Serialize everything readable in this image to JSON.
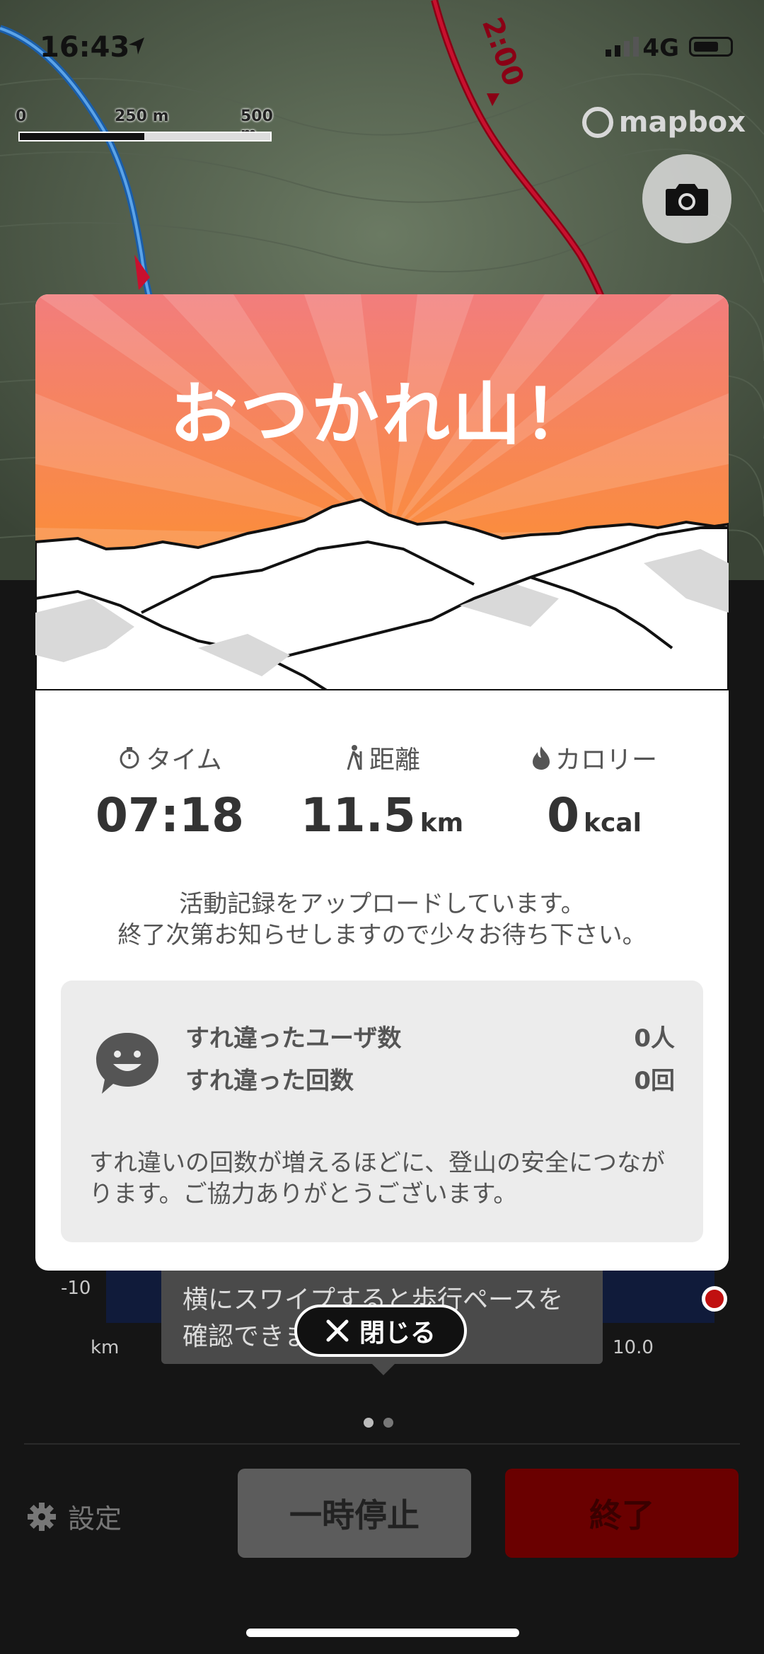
{
  "status": {
    "time": "16:43",
    "network": "4G"
  },
  "map": {
    "scale_labels": [
      "0",
      "250 m",
      "500 m"
    ],
    "brand": "mapbox",
    "route_label": "2:00"
  },
  "modal": {
    "title": "おつかれ山！",
    "stats": [
      {
        "label": "タイム",
        "value": "07:18",
        "unit": "",
        "icon": "stopwatch-icon"
      },
      {
        "label": "距離",
        "value": "11.5",
        "unit": "km",
        "icon": "hiker-icon"
      },
      {
        "label": "カロリー",
        "value": "0",
        "unit": "kcal",
        "icon": "flame-icon"
      }
    ],
    "note_line1": "活動記録をアップロードしています。",
    "note_line2": "終了次第お知らせしますので少々お待ち下さい。",
    "pass": {
      "users_label": "すれ違ったユーザ数",
      "users_value": "0人",
      "count_label": "すれ違った回数",
      "count_value": "0回",
      "note": "すれ違いの回数が増えるほどに、登山の安全につながります。ご協力ありがとうございます。"
    }
  },
  "close_label": "閉じる",
  "background": {
    "y_tick": "-10",
    "x_unit": "km",
    "x_end": "10.0",
    "tooltip": "横にスワイプすると歩行ペースを確認できます"
  },
  "controls": {
    "settings_label": "設定",
    "pause_label": "一時停止",
    "end_label": "終了"
  },
  "colors": {
    "hero_top": "#f27d7d",
    "hero_bottom": "#fb8d3a",
    "end_button": "#6a0000",
    "route": "#c8102e"
  }
}
